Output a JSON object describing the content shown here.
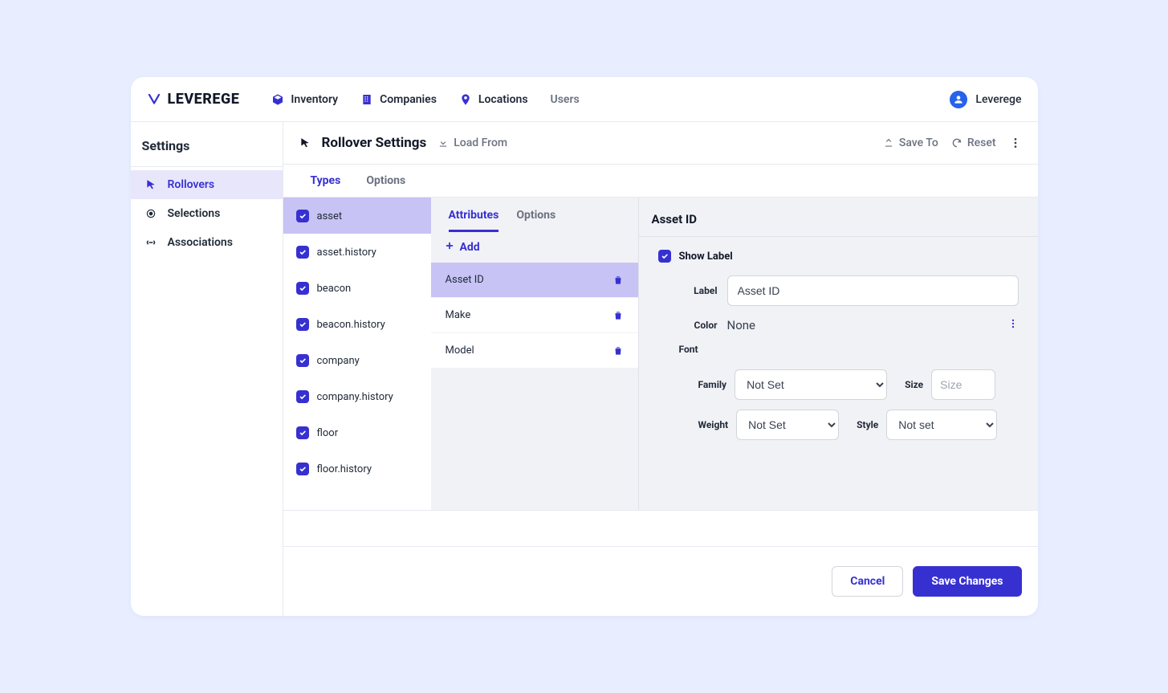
{
  "brand": "LEVEREGE",
  "nav": {
    "inventory": "Inventory",
    "companies": "Companies",
    "locations": "Locations",
    "users": "Users"
  },
  "user_name": "Leverege",
  "sidebar": {
    "title": "Settings",
    "items": [
      "Rollovers",
      "Selections",
      "Associations"
    ]
  },
  "header": {
    "page_title": "Rollover Settings",
    "load_from": "Load From",
    "save_to": "Save To",
    "reset": "Reset"
  },
  "tabs": {
    "types": "Types",
    "options": "Options"
  },
  "types": [
    "asset",
    "asset.history",
    "beacon",
    "beacon.history",
    "company",
    "company.history",
    "floor",
    "floor.history"
  ],
  "mid": {
    "tab_attributes": "Attributes",
    "tab_options": "Options",
    "add": "Add",
    "items": [
      "Asset ID",
      "Make",
      "Model"
    ]
  },
  "detail": {
    "title": "Asset ID",
    "show_label": "Show Label",
    "label_key": "Label",
    "label_value": "Asset ID",
    "color_key": "Color",
    "color_value": "None",
    "font_key": "Font",
    "family_key": "Family",
    "family_value": "Not Set",
    "size_key": "Size",
    "size_placeholder": "Size",
    "weight_key": "Weight",
    "weight_value": "Not Set",
    "style_key": "Style",
    "style_value": "Not set"
  },
  "footer": {
    "cancel": "Cancel",
    "save": "Save Changes"
  }
}
